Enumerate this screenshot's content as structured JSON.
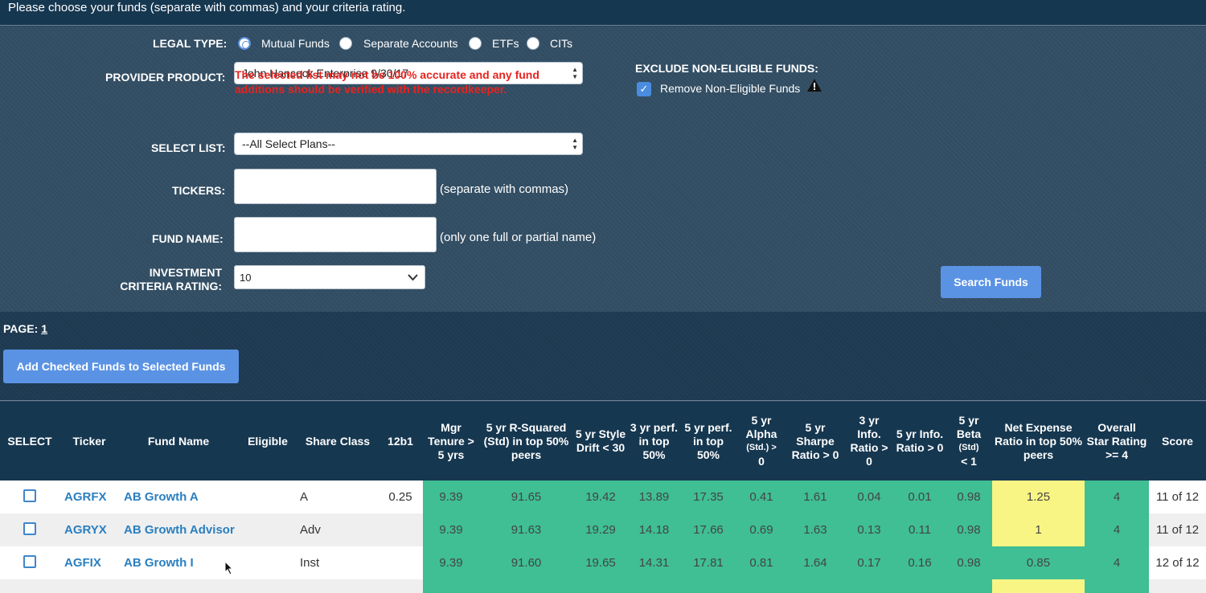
{
  "header": {
    "instructions": "Please choose your funds (separate with commas) and your criteria rating."
  },
  "form": {
    "legal_type": {
      "label": "LEGAL TYPE:",
      "options": [
        "Mutual Funds",
        "Separate Accounts",
        "ETFs",
        "CITs"
      ],
      "selected": "Mutual Funds"
    },
    "provider_product": {
      "label": "PROVIDER PRODUCT:",
      "value": "John Hancock Enterprise 9/30/17"
    },
    "warning": "The selected list may not be 100% accurate and any fund additions should be verified with the recordkeeper.",
    "select_list": {
      "label": "SELECT LIST:",
      "value": "--All Select Plans--"
    },
    "tickers": {
      "label": "TICKERS:",
      "value": "",
      "hint": "(separate with commas)"
    },
    "fund_name": {
      "label": "FUND NAME:",
      "value": "",
      "hint": "(only one full or partial name)"
    },
    "criteria": {
      "label_line1": "INVESTMENT",
      "label_line2": "CRITERIA RATING:",
      "value": "10"
    },
    "exclude": {
      "title": "EXCLUDE NON-ELIGIBLE FUNDS:",
      "checkbox_label": "Remove Non-Eligible Funds",
      "checked": true
    },
    "search_button": "Search Funds"
  },
  "pager": {
    "label": "PAGE:",
    "page": "1",
    "add_button": "Add Checked Funds to Selected Funds"
  },
  "table": {
    "headers": {
      "select": "SELECT",
      "ticker": "Ticker",
      "fund_name": "Fund Name",
      "eligible": "Eligible",
      "share_class": "Share Class",
      "b1": "12b1",
      "mgr": "Mgr Tenure > 5 yrs",
      "rsq": "5 yr R-Squared (Std) in top 50% peers",
      "style": "5 yr Style Drift < 30",
      "perf3": "3 yr perf. in top 50%",
      "perf5": "5 yr perf. in top 50%",
      "alpha_a": "5 yr Alpha",
      "alpha_b": "(Std.) >",
      "alpha_c": "0",
      "sharpe": "5 yr Sharpe Ratio > 0",
      "info3": "3 yr Info. Ratio > 0",
      "info5": "5 yr Info. Ratio > 0",
      "beta_a": "5 yr Beta",
      "beta_b": "(Std)",
      "beta_c": "< 1",
      "expense": "Net Expense Ratio in top 50% peers",
      "stars": "Overall Star Rating >= 4",
      "score": "Score"
    },
    "rows": [
      {
        "ticker": "AGRFX",
        "fund_name": "AB Growth A",
        "eligible": "",
        "share_class": "A",
        "b1": "0.25",
        "mgr": "9.39",
        "rsq": "91.65",
        "style": "19.42",
        "perf3": "13.89",
        "perf5": "17.35",
        "alpha": "0.41",
        "sharpe": "1.61",
        "info3": "0.04",
        "info5": "0.01",
        "beta": "0.98",
        "expense": "1.25",
        "stars": "4",
        "score": "11 of 12",
        "expense_flag": true
      },
      {
        "ticker": "AGRYX",
        "fund_name": "AB Growth Advisor",
        "eligible": "",
        "share_class": "Adv",
        "b1": "",
        "mgr": "9.39",
        "rsq": "91.63",
        "style": "19.29",
        "perf3": "14.18",
        "perf5": "17.66",
        "alpha": "0.69",
        "sharpe": "1.63",
        "info3": "0.13",
        "info5": "0.11",
        "beta": "0.98",
        "expense": "1",
        "stars": "4",
        "score": "11 of 12",
        "expense_flag": true
      },
      {
        "ticker": "AGFIX",
        "fund_name": "AB Growth I",
        "eligible": "",
        "share_class": "Inst",
        "b1": "",
        "mgr": "9.39",
        "rsq": "91.60",
        "style": "19.65",
        "perf3": "14.31",
        "perf5": "17.81",
        "alpha": "0.81",
        "sharpe": "1.64",
        "info3": "0.17",
        "info5": "0.16",
        "beta": "0.98",
        "expense": "0.85",
        "stars": "4",
        "score": "12 of 12",
        "expense_flag": false
      }
    ]
  },
  "colors": {
    "pass": "#3fbf93",
    "fail": "#f8f584",
    "header": "#163750",
    "link": "#2a7fc0",
    "button": "#5b93e4",
    "warning": "#e8231f"
  }
}
